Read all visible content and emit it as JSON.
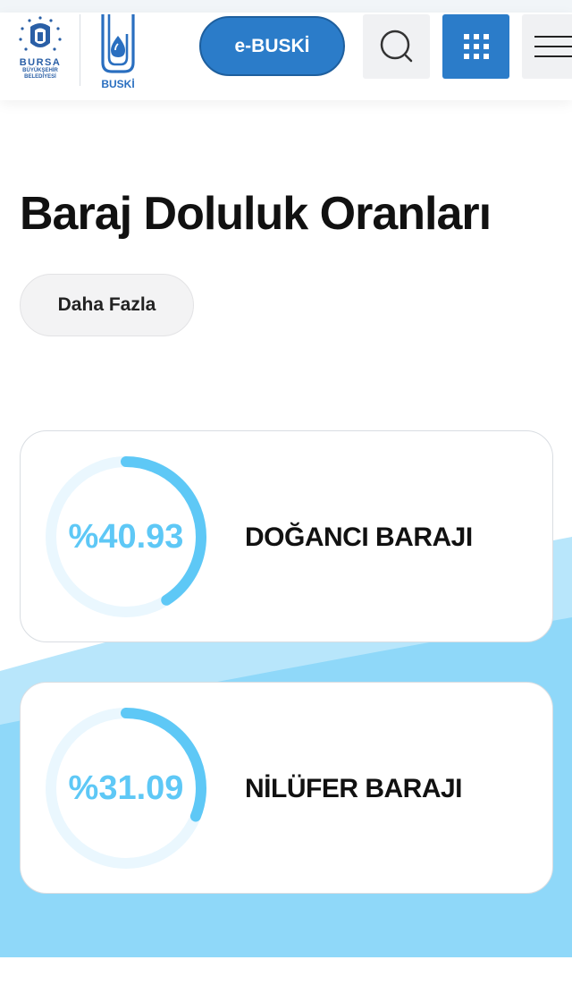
{
  "header": {
    "logo_bursa_line1": "BURSA",
    "logo_bursa_line2": "BÜYÜKŞEHİR",
    "logo_bursa_line3": "BELEDİYESİ",
    "logo_buski": "BUSKİ",
    "ebuski_label": "e-BUSKİ",
    "icons": {
      "search": "search-icon",
      "apps": "grid-icon",
      "menu": "hamburger-menu-icon"
    },
    "colors": {
      "primary": "#2b7cc9",
      "button_gray": "#f0f1f3"
    }
  },
  "main": {
    "title": "Baraj Doluluk Oranları",
    "more_label": "Daha Fazla"
  },
  "dams": [
    {
      "name": "DOĞANCI BARAJI",
      "percent_label": "%40.93",
      "fill_percent": 40.93
    },
    {
      "name": "NİLÜFER BARAJI",
      "percent_label": "%31.09",
      "fill_percent": 31.09
    }
  ],
  "colors": {
    "gauge_fill": "#5ec8f6",
    "gauge_track": "#eaf7fe",
    "wave_light": "#b8e6fb",
    "wave_dark": "#8fd8f9"
  }
}
